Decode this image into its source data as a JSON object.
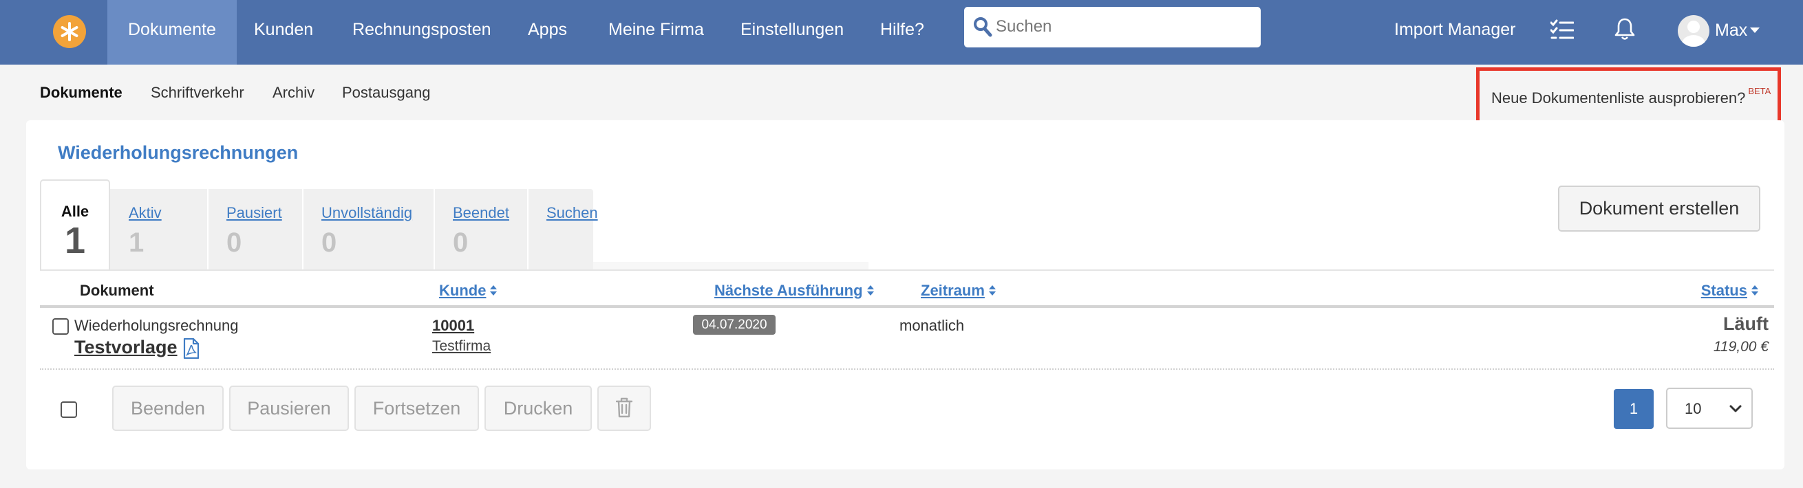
{
  "brand": {
    "accent": "#4d70aa",
    "logo_color": "#f2a33a",
    "link_color": "#3f7cc4"
  },
  "navbar": {
    "items": [
      {
        "label": "Dokumente",
        "active": true
      },
      {
        "label": "Kunden"
      },
      {
        "label": "Rechnungsposten"
      },
      {
        "label": "Apps"
      },
      {
        "label": "Meine Firma"
      },
      {
        "label": "Einstellungen"
      },
      {
        "label": "Hilfe?"
      }
    ],
    "search_placeholder": "Suchen",
    "import_manager": "Import Manager",
    "user_name": "Max",
    "icons": [
      "star-logo-icon",
      "search-icon",
      "checklist-icon",
      "bell-icon",
      "avatar-icon",
      "caret-down-icon"
    ]
  },
  "subnav": {
    "items": [
      {
        "label": "Dokumente",
        "active": true
      },
      {
        "label": "Schriftverkehr"
      },
      {
        "label": "Archiv"
      },
      {
        "label": "Postausgang"
      }
    ],
    "beta_link": "Neue Dokumentenliste ausprobieren?",
    "beta_tag": "BETA"
  },
  "main": {
    "title": "Wiederholungsrechnungen",
    "tabs": [
      {
        "label": "Alle",
        "count": "1",
        "active": true
      },
      {
        "label": "Aktiv",
        "count": "1"
      },
      {
        "label": "Pausiert",
        "count": "0"
      },
      {
        "label": "Unvollständig",
        "count": "0"
      },
      {
        "label": "Beendet",
        "count": "0"
      },
      {
        "label": "Suchen",
        "count": ""
      }
    ],
    "create_button": "Dokument erstellen",
    "table": {
      "columns": [
        "Dokument",
        "Kunde",
        "Nächste Ausführung",
        "Zeitraum",
        "Status"
      ],
      "rows": [
        {
          "doc_type": "Wiederholungsrechnung",
          "doc_name": "Testvorlage",
          "customer_number": "10001",
          "customer_name": "Testfirma",
          "next_run": "04.07.2020",
          "period": "monatlich",
          "status": "Läuft",
          "amount": "119,00 €"
        }
      ]
    },
    "actions": [
      "Beenden",
      "Pausieren",
      "Fortsetzen",
      "Drucken"
    ],
    "pagination": {
      "current_page": "1",
      "per_page": "10"
    }
  }
}
